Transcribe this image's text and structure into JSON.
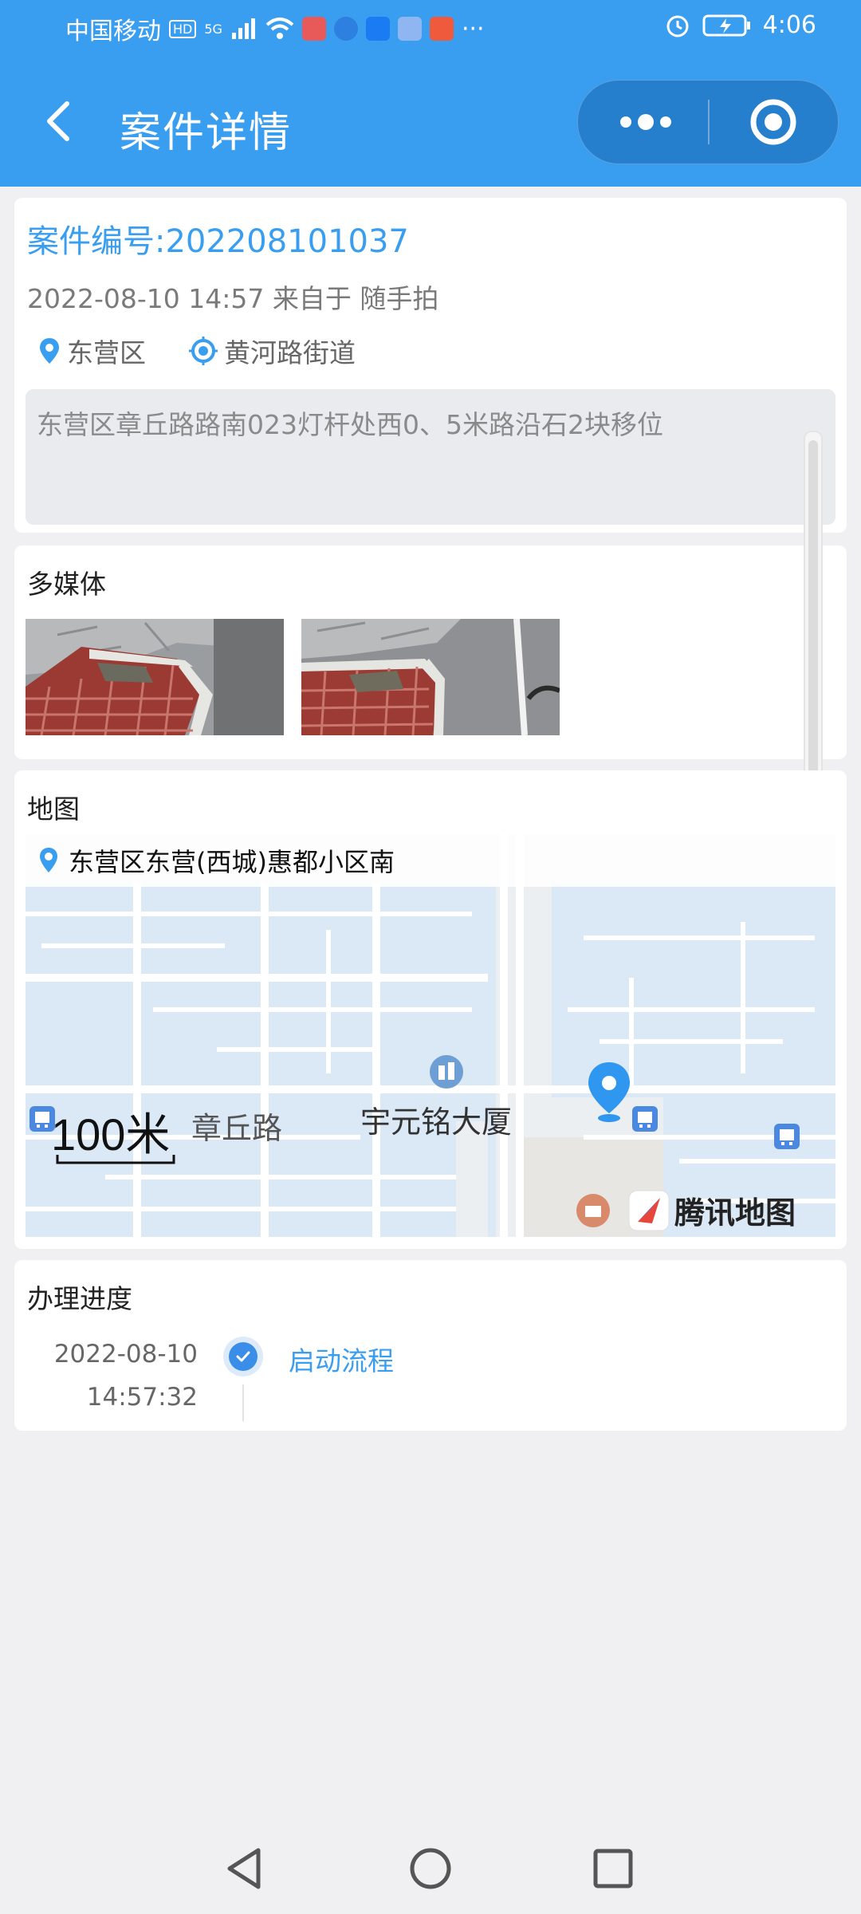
{
  "status_bar": {
    "carrier": "中国移动",
    "network": "5G",
    "time": "4:06"
  },
  "header": {
    "title": "案件详情"
  },
  "case": {
    "number": "案件编号:202208101037",
    "meta": "2022-08-10 14:57 来自于 随手拍",
    "district": "东营区",
    "street": "黄河路街道",
    "description": "东营区章丘路路南023灯杆处西0、5米路沿石2块移位"
  },
  "media": {
    "title": "多媒体",
    "images": [
      "sidewalk-photo-1",
      "sidewalk-photo-2"
    ]
  },
  "map": {
    "title": "地图",
    "address": "东营区东营(西城)惠都小区南",
    "scale": "100米",
    "road": "章丘路",
    "poi": "宇元铭大厦",
    "provider": "腾讯地图"
  },
  "progress": {
    "title": "办理进度",
    "steps": [
      {
        "date": "2022-08-10",
        "time": "14:57:32",
        "label": "启动流程"
      }
    ]
  },
  "colors": {
    "accent": "#3a9ef0",
    "map_block": "#dce9f7",
    "map_road": "#ffffff"
  },
  "icons": [
    "back-arrow-icon",
    "more-dots-icon",
    "mini-program-close-icon",
    "location-pin-icon",
    "target-pin-icon",
    "map-marker-icon",
    "bus-stop-icon",
    "building-poi-icon",
    "check-icon",
    "triangle-back-icon",
    "circle-home-icon",
    "square-recent-icon"
  ]
}
